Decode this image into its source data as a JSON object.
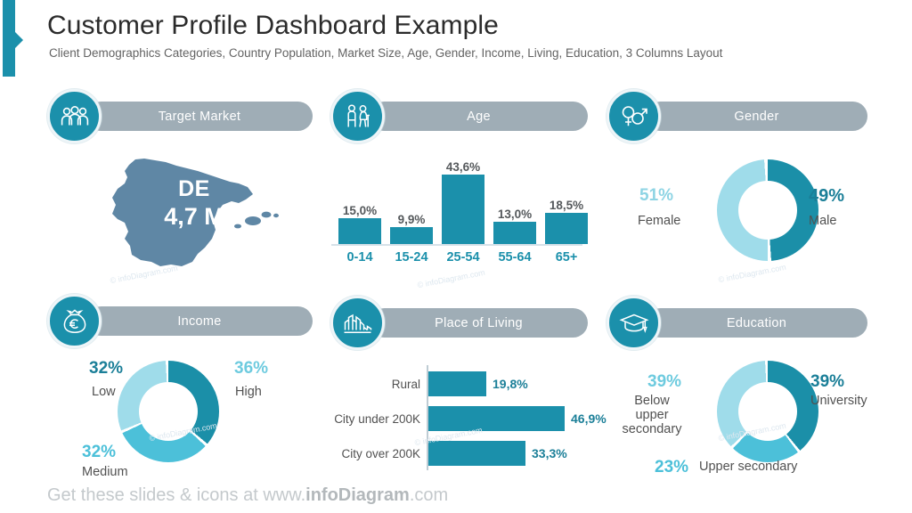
{
  "header": {
    "title": "Customer Profile Dashboard Example",
    "subtitle": "Client Demographics Categories, Country Population, Market Size, Age, Gender, Income, Living, Education, 3 Columns Layout"
  },
  "footer": {
    "prefix": "Get these slides & icons at www.",
    "brand": "infoDiagram",
    "suffix": ".com"
  },
  "watermark": "© infoDiagram.com",
  "colors": {
    "teal_dark": "#1b90ab",
    "teal_mid": "#4cc0d9",
    "teal_pale": "#9fdcea",
    "gray_pill": "#9fadb6",
    "map_blue": "#5f87a5",
    "label_gray": "#515151"
  },
  "sections": {
    "target_market": {
      "title": "Target Market",
      "icon": "people-icon"
    },
    "age": {
      "title": "Age",
      "icon": "age-people-icon"
    },
    "gender": {
      "title": "Gender",
      "icon": "gender-symbols-icon"
    },
    "income": {
      "title": "Income",
      "icon": "money-bag-euro-icon"
    },
    "living": {
      "title": "Place of Living",
      "icon": "city-skyline-icon"
    },
    "education": {
      "title": "Education",
      "icon": "graduation-cap-icon"
    }
  },
  "map": {
    "country_code": "DE",
    "population": "4,7 M"
  },
  "chart_data": [
    {
      "type": "bar",
      "id": "age-distribution",
      "title": "Age",
      "categories": [
        "0-14",
        "15-24",
        "25-54",
        "55-64",
        "65+"
      ],
      "values": [
        15.0,
        9.9,
        43.6,
        13.0,
        18.5
      ],
      "value_labels": [
        "15,0%",
        "9,9%",
        "43,6%",
        "13,0%",
        "18,5%"
      ],
      "xlabel": "",
      "ylabel": "",
      "ylim": [
        0,
        43.6
      ],
      "grid": false,
      "legend": "none",
      "series_color": "#1b90ab"
    },
    {
      "type": "pie",
      "id": "gender-split",
      "title": "Gender",
      "categories": [
        "Female",
        "Male"
      ],
      "values": [
        51,
        49
      ],
      "value_labels": [
        "51%",
        "49%"
      ],
      "colors": [
        "#9fdcea",
        "#1b8fa8"
      ],
      "legend": "sides"
    },
    {
      "type": "pie",
      "id": "income-split",
      "title": "Income",
      "categories": [
        "High",
        "Medium",
        "Low"
      ],
      "values": [
        36,
        32,
        32
      ],
      "value_labels": [
        "36%",
        "32%",
        "32%"
      ],
      "colors": [
        "#1b8fa8",
        "#4cc0d9",
        "#9fdcea"
      ],
      "legend": "sides"
    },
    {
      "type": "bar",
      "id": "place-of-living",
      "title": "Place of Living",
      "orientation": "horizontal",
      "categories": [
        "Rural",
        "City under 200K",
        "City over 200K"
      ],
      "values": [
        19.8,
        46.9,
        33.3
      ],
      "value_labels": [
        "19,8%",
        "46,9%",
        "33,3%"
      ],
      "xlim": [
        0,
        46.9
      ],
      "grid": false,
      "legend": "none",
      "series_color": "#1b90ab"
    },
    {
      "type": "pie",
      "id": "education-split",
      "title": "Education",
      "categories": [
        "University",
        "Upper secondary",
        "Below upper secondary"
      ],
      "values": [
        39,
        23,
        39
      ],
      "value_labels": [
        "39%",
        "23%",
        "39%"
      ],
      "colors": [
        "#1b8fa8",
        "#4cc0d9",
        "#9fdcea"
      ],
      "legend": "sides"
    }
  ],
  "gender_legend": {
    "female_pct": "51%",
    "female_label": "Female",
    "male_pct": "49%",
    "male_label": "Male"
  },
  "income_legend": {
    "high_pct": "36%",
    "high_label": "High",
    "medium_pct": "32%",
    "medium_label": "Medium",
    "low_pct": "32%",
    "low_label": "Low"
  },
  "education_legend": {
    "university_pct": "39%",
    "university_label": "University",
    "upper_pct": "23%",
    "upper_label": "Upper secondary",
    "below_pct": "39%",
    "below_label": "Below\nupper\nsecondary"
  }
}
